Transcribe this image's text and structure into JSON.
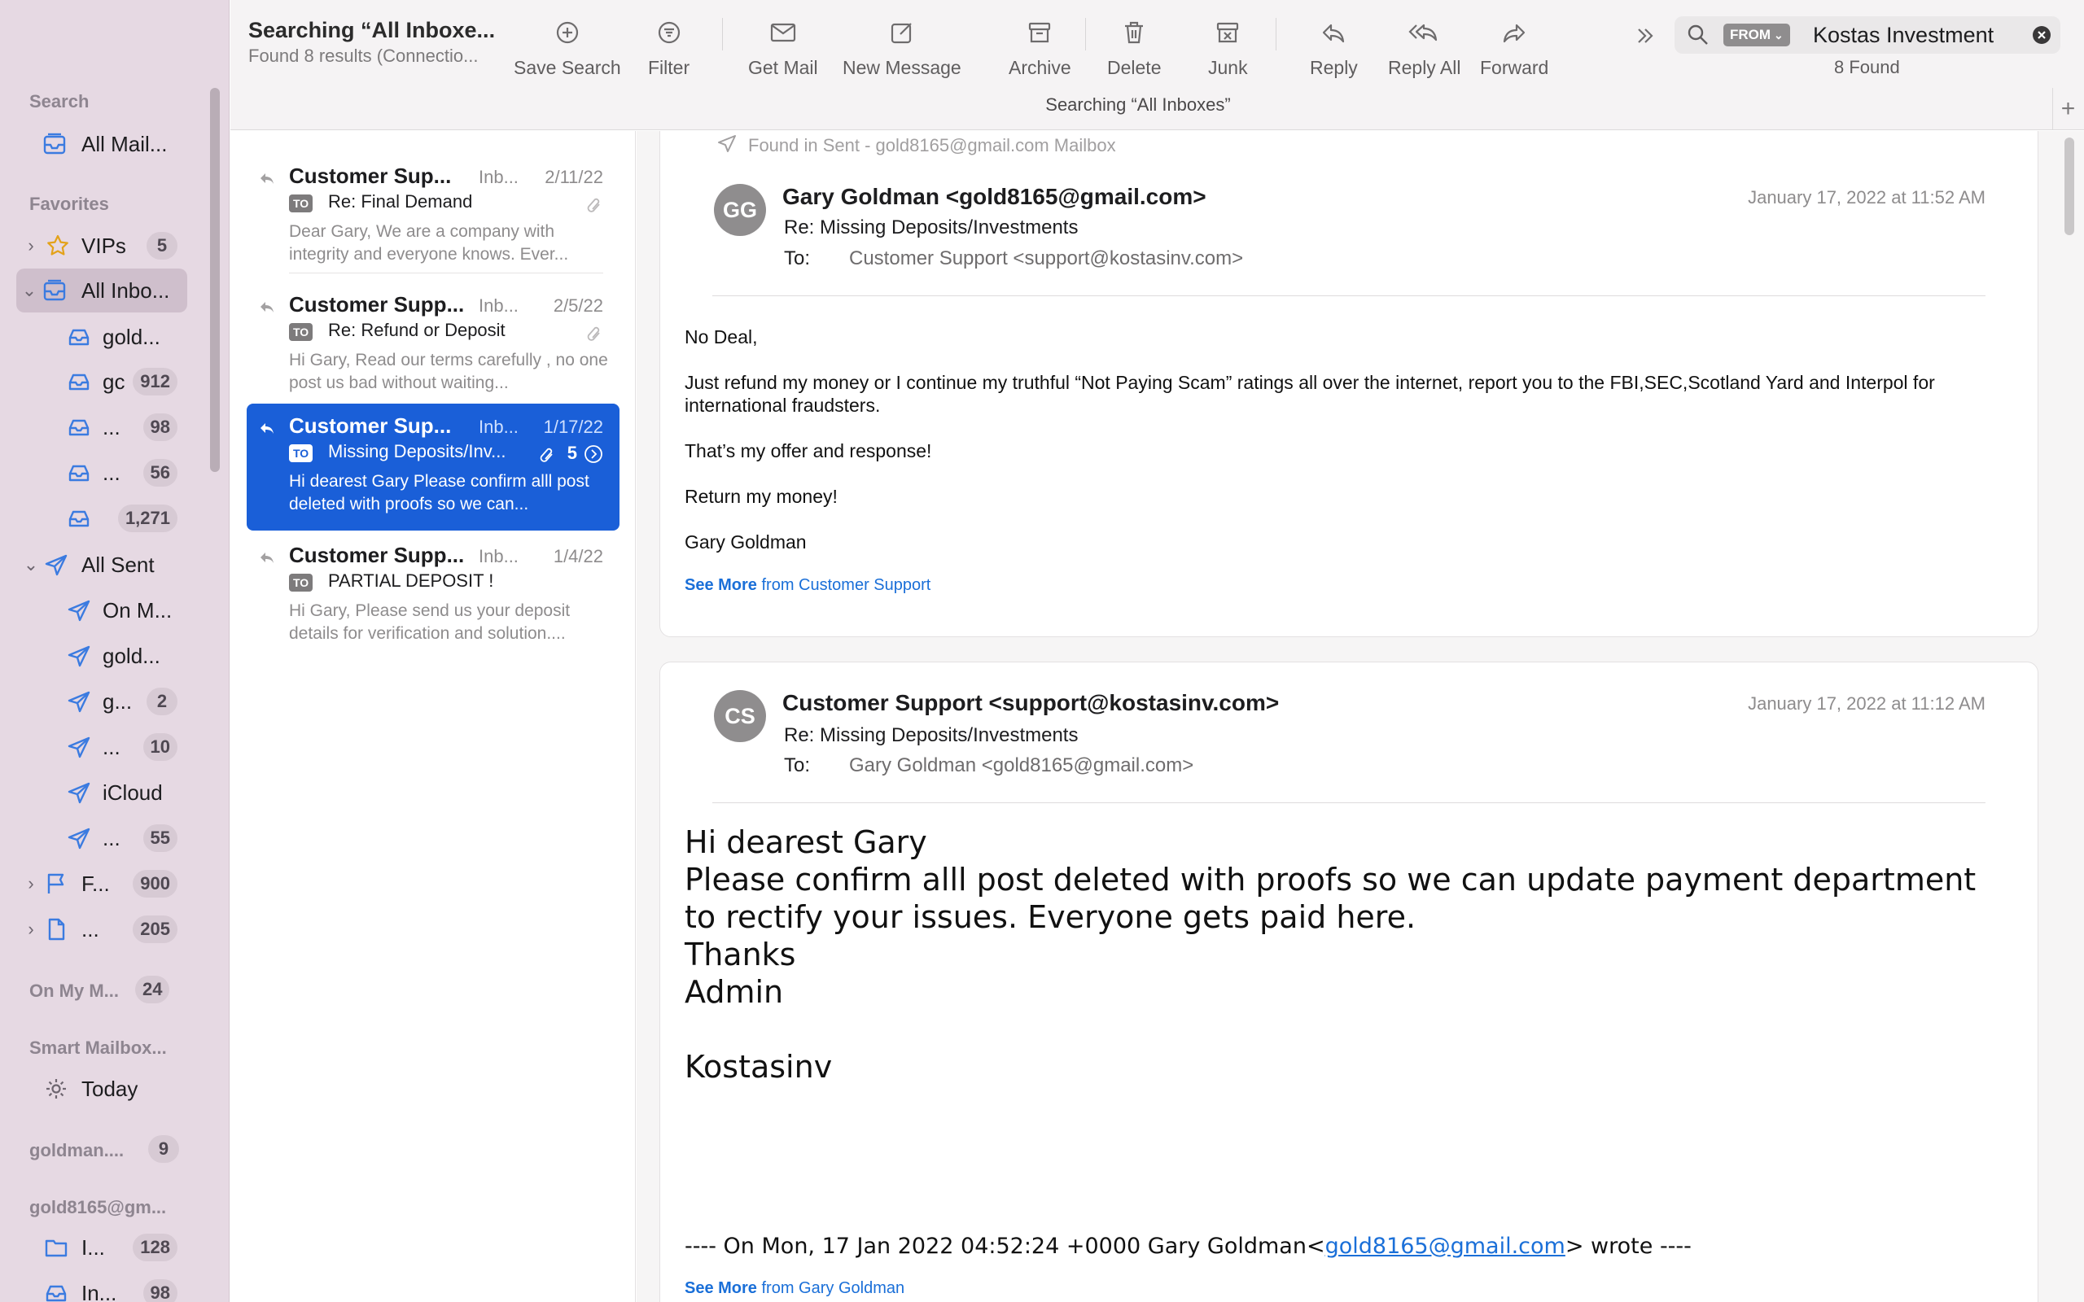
{
  "sidebar": {
    "sections": {
      "search": "Search",
      "favorites": "Favorites",
      "on_my_mac": "On My M...",
      "on_my_mac_badge": "24",
      "smart": "Smart Mailbox...",
      "goldman": "goldman....",
      "goldman_badge": "9",
      "gold8165": "gold8165@gm..."
    },
    "search_all_mail": "All Mail...",
    "vips": {
      "label": "VIPs",
      "badge": "5"
    },
    "all_inboxes": "All Inbo...",
    "inboxes": [
      {
        "label": "gold...",
        "badge": ""
      },
      {
        "label": "gc",
        "badge": "912"
      },
      {
        "label": "...",
        "badge": "98"
      },
      {
        "label": "...",
        "badge": "56"
      },
      {
        "label": "",
        "badge": "1,271"
      }
    ],
    "all_sent": "All Sent",
    "sent": [
      {
        "label": "On M...",
        "badge": ""
      },
      {
        "label": "gold...",
        "badge": ""
      },
      {
        "label": "g...",
        "badge": "2"
      },
      {
        "label": "...",
        "badge": "10"
      },
      {
        "label": "iCloud",
        "badge": ""
      },
      {
        "label": "...",
        "badge": "55"
      }
    ],
    "flagged": {
      "label": "F...",
      "badge": "900"
    },
    "drafts": {
      "label": "...",
      "badge": "205"
    },
    "today": "Today",
    "gold_items": [
      {
        "label": "I...",
        "badge": "128"
      },
      {
        "label": "In...",
        "badge": "98"
      }
    ]
  },
  "toolbar": {
    "title": "Searching “All Inboxe...",
    "subtitle": "Found 8 results (Connectio...",
    "save_search": "Save Search",
    "filter": "Filter",
    "get_mail": "Get Mail",
    "new_message": "New Message",
    "archive": "Archive",
    "delete": "Delete",
    "junk": "Junk",
    "reply": "Reply",
    "reply_all": "Reply All",
    "forward": "Forward",
    "search_token": "FROM",
    "search_value": "Kostas Investment",
    "found": "8 Found",
    "scope": "Searching “All Inboxes”",
    "add": "+"
  },
  "messages": [
    {
      "sender": "Customer Sup...",
      "mailbox": "Inb...",
      "date": "2/11/22",
      "to_tag": "TO",
      "subject": "Re: Final Demand",
      "preview": "Dear Gary, We are a company with integrity and everyone knows. Ever..."
    },
    {
      "sender": "Customer Supp...",
      "mailbox": "Inb...",
      "date": "2/5/22",
      "to_tag": "TO",
      "subject": "Re: Refund  or Deposit",
      "preview": "Hi Gary, Read our terms carefully , no one post us bad without waiting..."
    },
    {
      "sender": "Customer Sup...",
      "mailbox": "Inb...",
      "date": "1/17/22",
      "to_tag": "TO",
      "subject": "Missing Deposits/Inv...",
      "thread_count": "5",
      "preview": "Hi dearest Gary Please confirm alll post deleted with proofs so we can..."
    },
    {
      "sender": "Customer Supp...",
      "mailbox": "Inb...",
      "date": "1/4/22",
      "to_tag": "TO",
      "subject": "PARTIAL DEPOSIT !",
      "preview": "Hi Gary, Please send us your deposit details for verification and solution...."
    }
  ],
  "viewer": {
    "found_in": "Found in Sent - gold8165@gmail.com Mailbox",
    "email1": {
      "initials": "GG",
      "from": "Gary Goldman <gold8165@gmail.com>",
      "subject": "Re: Missing Deposits/Investments",
      "to_label": "To:",
      "to": "Customer Support <support@kostasinv.com>",
      "date": "January 17, 2022 at 11:52 AM",
      "body": [
        "No Deal,",
        "Just refund my money or I continue my truthful “Not Paying Scam” ratings all over the internet, report you to the FBI,SEC,Scotland Yard and Interpol for international fraudsters.",
        "That’s my offer and response!",
        "Return my money!",
        "Gary Goldman"
      ],
      "see_more": "See More",
      "see_more_from": "from Customer Support"
    },
    "email2": {
      "initials": "CS",
      "from": "Customer Support <support@kostasinv.com>",
      "subject": "Re: Missing Deposits/Investments",
      "to_label": "To:",
      "to": "Gary Goldman <gold8165@gmail.com>",
      "date": "January 17, 2022 at 11:12 AM",
      "body": [
        "Hi dearest Gary",
        "Please confirm alll post deleted with proofs so we can update payment department to rectify your issues. Everyone gets paid here.",
        "Thanks",
        "Admin",
        "Kostasinv"
      ],
      "quote_prefix": "---- On Mon, 17 Jan 2022 04:52:24 +0000 Gary Goldman<",
      "quote_email": "gold8165@gmail.com",
      "quote_suffix": "> wrote ----",
      "see_more": "See More",
      "see_more_from": "from Gary Goldman"
    }
  }
}
